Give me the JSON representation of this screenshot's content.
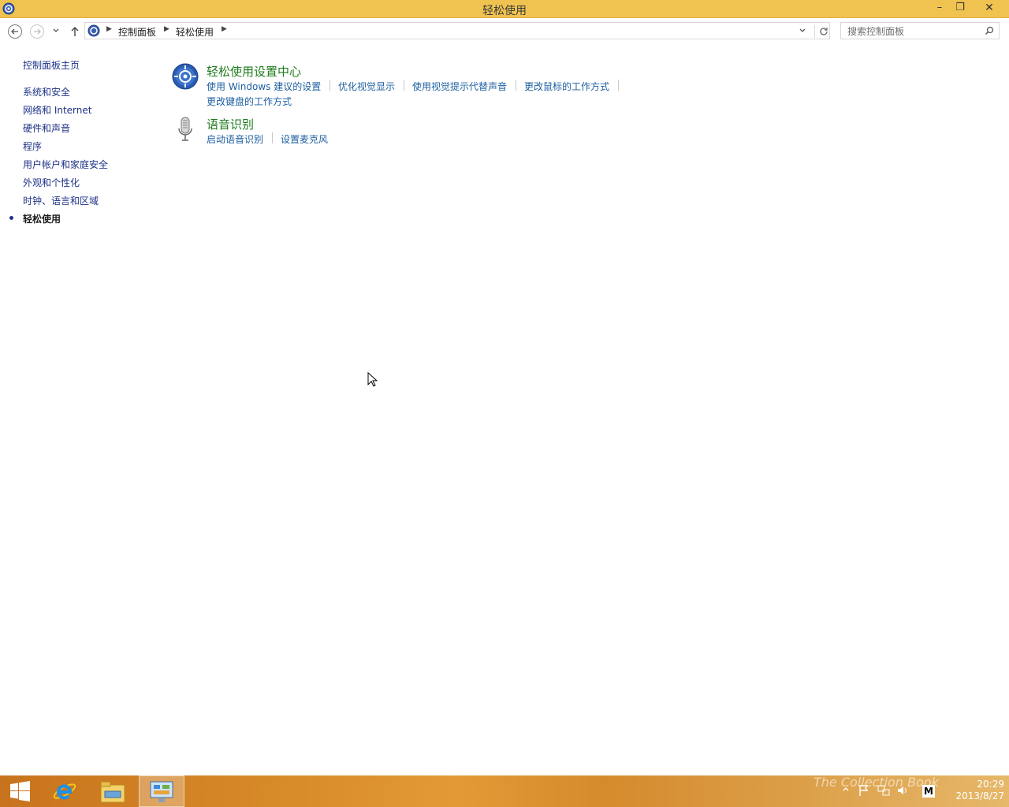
{
  "window": {
    "title": "轻松使用",
    "minimize_label": "–",
    "maximize_label": "❐",
    "close_label": "✕"
  },
  "address": {
    "crumbs": [
      "控制面板",
      "轻松使用"
    ],
    "search_placeholder": "搜索控制面板"
  },
  "sidebar": {
    "home": "控制面板主页",
    "items": [
      "系统和安全",
      "网络和 Internet",
      "硬件和声音",
      "程序",
      "用户帐户和家庭安全",
      "外观和个性化",
      "时钟、语言和区域",
      "轻松使用"
    ],
    "active_index": 7
  },
  "categories": [
    {
      "title": "轻松使用设置中心",
      "icon": "ease-of-access-icon",
      "links": [
        "使用 Windows 建议的设置",
        "优化视觉显示",
        "使用视觉提示代替声音",
        "更改鼠标的工作方式",
        "更改键盘的工作方式"
      ]
    },
    {
      "title": "语音识别",
      "icon": "microphone-icon",
      "links": [
        "启动语音识别",
        "设置麦克风"
      ]
    }
  ],
  "taskbar": {
    "apps": [
      "start-icon",
      "internet-explorer-icon",
      "file-explorer-icon",
      "control-panel-icon"
    ],
    "active_app": "control-panel-icon",
    "time": "20:29",
    "date": "2013/8/27",
    "watermark": "The Collection Book"
  },
  "colors": {
    "titlebar": "#f0c350",
    "link": "#1e5fa0",
    "category_title": "#1e7b1e",
    "nav_link": "#1e3287"
  }
}
